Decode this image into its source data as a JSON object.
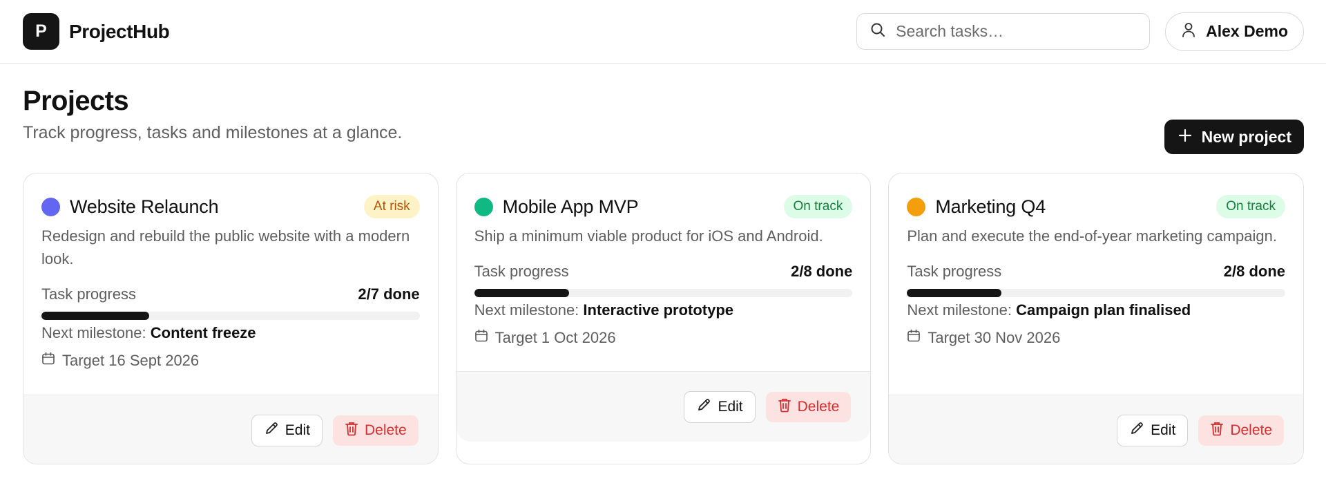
{
  "app": {
    "logo_letter": "P",
    "name": "ProjectHub"
  },
  "search": {
    "placeholder": "Search tasks…",
    "value": ""
  },
  "user": {
    "name": "Alex Demo"
  },
  "page": {
    "title": "Projects",
    "subtitle": "Track progress, tasks and milestones at a glance.",
    "new_button": "New project"
  },
  "colors": {
    "indigo": "#6366f1",
    "green": "#10b981",
    "amber": "#f59e0b",
    "at_risk_bg": "#fef3c7",
    "at_risk_fg": "#b45309",
    "on_track_bg": "#dcfce7",
    "on_track_fg": "#15803d"
  },
  "projects": [
    {
      "title": "Website Relaunch",
      "status": "At risk",
      "description": "Redesign and rebuild the public website with a modern look.",
      "progress_label": "Task progress",
      "progress_text": "2/7 done",
      "progress_fraction": 0.2857,
      "milestone_label": "Next milestone:",
      "milestone": "Content freeze",
      "target": "Target 16 Sept 2026",
      "edit_label": "Edit",
      "delete_label": "Delete"
    },
    {
      "title": "Mobile App MVP",
      "status": "On track",
      "description": "Ship a minimum viable product for iOS and Android.",
      "progress_label": "Task progress",
      "progress_text": "2/8 done",
      "progress_fraction": 0.25,
      "milestone_label": "Next milestone:",
      "milestone": "Interactive prototype",
      "target": "Target 1 Oct 2026",
      "edit_label": "Edit",
      "delete_label": "Delete"
    },
    {
      "title": "Marketing Q4",
      "status": "On track",
      "description": "Plan and execute the end-of-year marketing campaign.",
      "progress_label": "Task progress",
      "progress_text": "2/8 done",
      "progress_fraction": 0.25,
      "milestone_label": "Next milestone:",
      "milestone": "Campaign plan finalised",
      "target": "Target 30 Nov 2026",
      "edit_label": "Edit",
      "delete_label": "Delete"
    }
  ]
}
